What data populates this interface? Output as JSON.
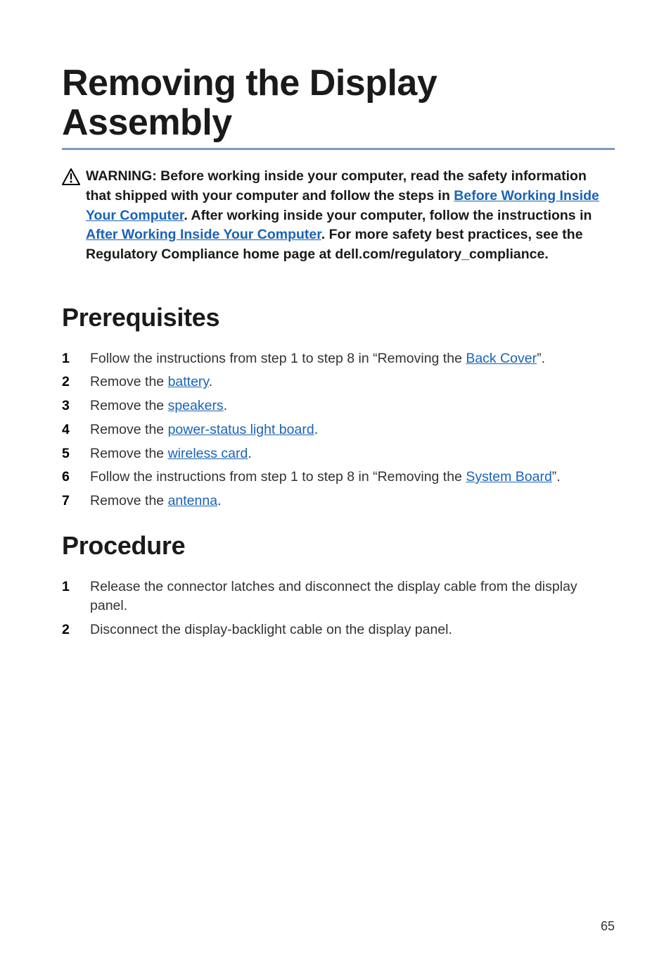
{
  "title": "Removing the Display Assembly",
  "warning": {
    "prefix": "WARNING: Before working inside your computer, read the safety information that shipped with your computer and follow the steps in ",
    "link1": "Before Working Inside Your Computer",
    "mid1": ". After working inside your computer, follow the instructions in ",
    "link2": "After Working Inside Your Computer",
    "suffix": ". For more safety best practices, see the Regulatory Compliance home page at dell.com/regulatory_compliance."
  },
  "sections": {
    "prerequisites": {
      "heading": "Prerequisites",
      "items": [
        {
          "pre": "Follow the instructions from step 1 to step 8 in “Removing the ",
          "link": "Back Cover",
          "post": "”."
        },
        {
          "pre": "Remove the ",
          "link": "battery",
          "post": "."
        },
        {
          "pre": "Remove the ",
          "link": "speakers",
          "post": "."
        },
        {
          "pre": "Remove the ",
          "link": "power-status light board",
          "post": "."
        },
        {
          "pre": "Remove the ",
          "link": "wireless card",
          "post": "."
        },
        {
          "pre": "Follow the instructions from step 1 to step 8 in “Removing the ",
          "link": "System Board",
          "post": "”."
        },
        {
          "pre": "Remove the ",
          "link": "antenna",
          "post": "."
        }
      ]
    },
    "procedure": {
      "heading": "Procedure",
      "items": [
        {
          "text": "Release the connector latches and disconnect the display cable from the display panel."
        },
        {
          "text": "Disconnect the display-backlight cable on the display panel."
        }
      ]
    }
  },
  "pageNumber": "65"
}
